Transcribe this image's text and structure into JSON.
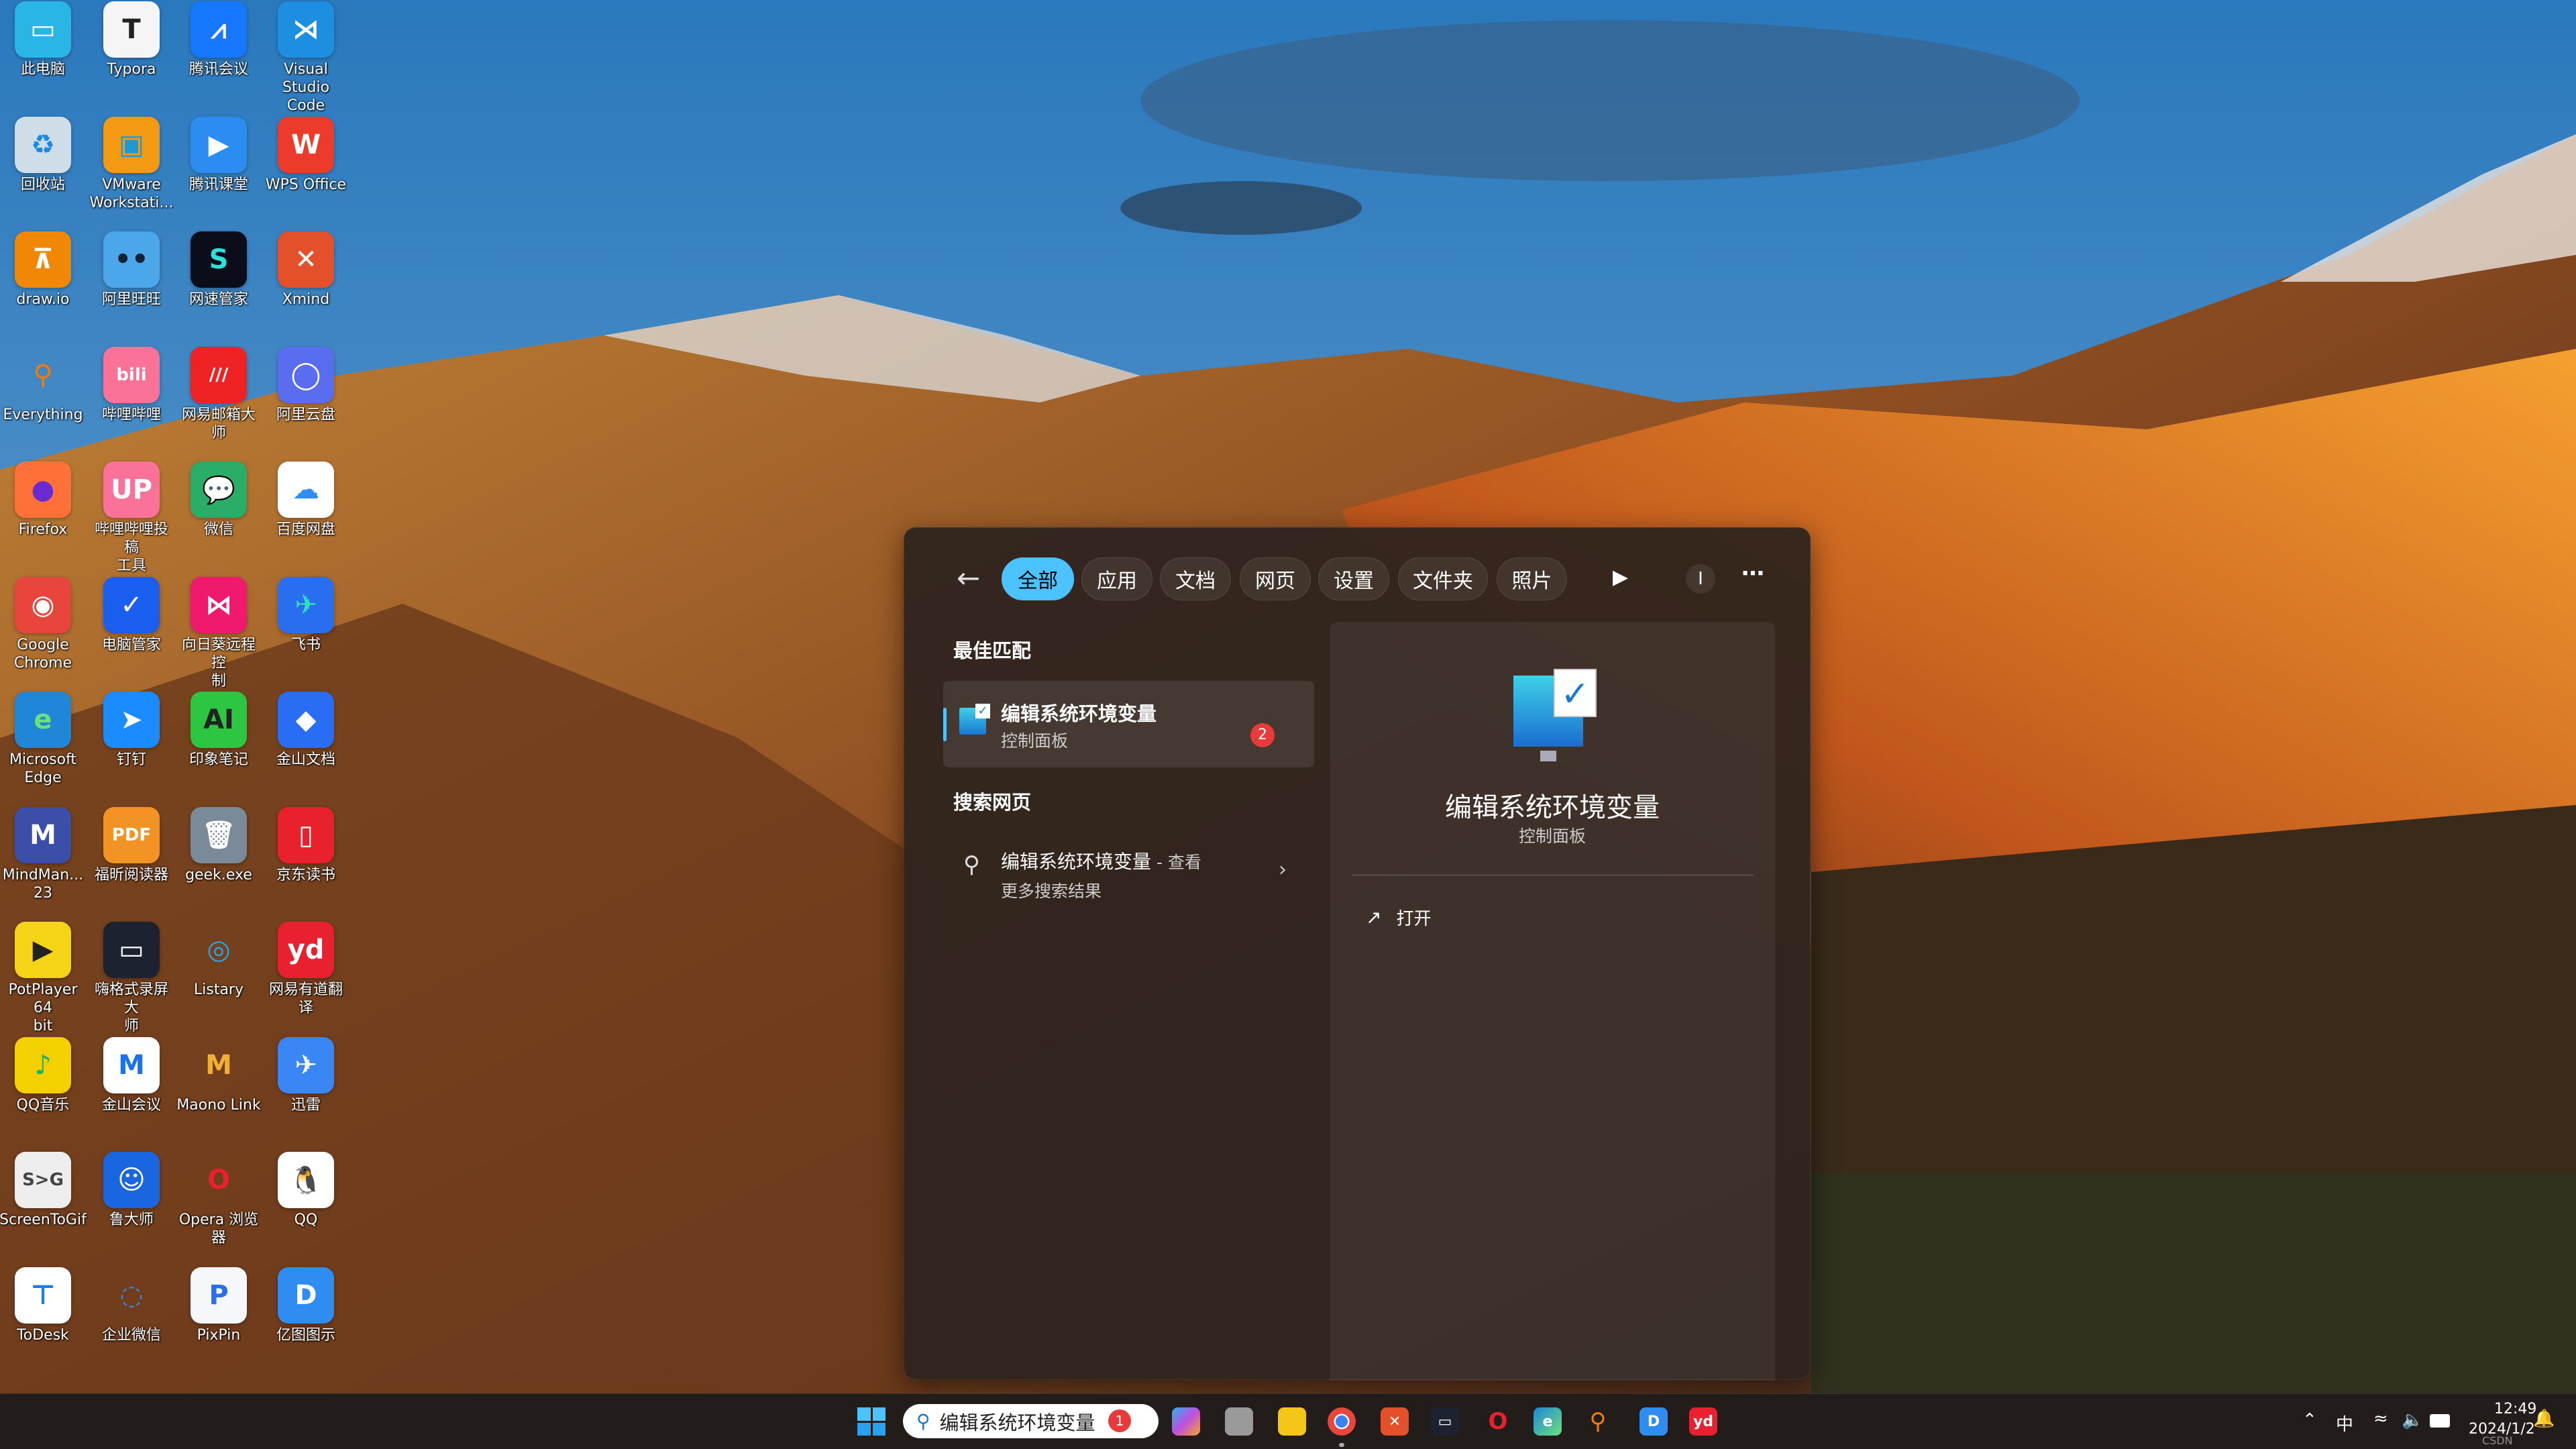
{
  "desktop": {
    "icons": [
      {
        "label": "此电脑",
        "bg": "#29b6e6",
        "fg": "#fff",
        "glyph": "▭"
      },
      {
        "label": "Typora",
        "bg": "#f5f5f5",
        "fg": "#222",
        "glyph": "T"
      },
      {
        "label": "腾讯会议",
        "bg": "#1677ff",
        "fg": "#fff",
        "glyph": "⩘"
      },
      {
        "label": "Visual\nStudio Code",
        "bg": "#1e8fe0",
        "fg": "#fff",
        "glyph": "⋊"
      },
      {
        "label": "回收站",
        "bg": "#cfdde8",
        "fg": "#1e88e5",
        "glyph": "♻"
      },
      {
        "label": "VMware\nWorkstati...",
        "bg": "#f39a12",
        "fg": "#1d9ad6",
        "glyph": "▣"
      },
      {
        "label": "腾讯课堂",
        "bg": "#2b8cf2",
        "fg": "#fff",
        "glyph": "▶"
      },
      {
        "label": "WPS Office",
        "bg": "#ec3b2b",
        "fg": "#fff",
        "glyph": "W"
      },
      {
        "label": "draw.io",
        "bg": "#f08705",
        "fg": "#fff",
        "glyph": "⊼"
      },
      {
        "label": "阿里旺旺",
        "bg": "#4ca6ea",
        "fg": "#123",
        "glyph": "••"
      },
      {
        "label": "网速管家",
        "bg": "#0b0d1a",
        "fg": "#2de0d8",
        "glyph": "S"
      },
      {
        "label": "Xmind",
        "bg": "#e4502a",
        "fg": "#fff",
        "glyph": "✕"
      },
      {
        "label": "Everything",
        "bg": "transparent",
        "fg": "#f57c00",
        "glyph": "⚲"
      },
      {
        "label": "哔哩哔哩",
        "bg": "#fb7299",
        "fg": "#fff",
        "glyph": "bili"
      },
      {
        "label": "网易邮箱大师",
        "bg": "#ee2222",
        "fg": "#fff",
        "glyph": "///"
      },
      {
        "label": "阿里云盘",
        "bg": "#5a6cf0",
        "fg": "#fff",
        "glyph": "◯"
      },
      {
        "label": "Firefox",
        "bg": "#ff7139",
        "fg": "#6a2ad0",
        "glyph": "●"
      },
      {
        "label": "哔哩哔哩投稿\n工具",
        "bg": "#fb7299",
        "fg": "#fff",
        "glyph": "UP"
      },
      {
        "label": "微信",
        "bg": "#2aae67",
        "fg": "#fff",
        "glyph": "💬"
      },
      {
        "label": "百度网盘",
        "bg": "#ffffff",
        "fg": "#2f8cf0",
        "glyph": "☁"
      },
      {
        "label": "Google\nChrome",
        "bg": "#e8453c",
        "fg": "#fff",
        "glyph": "◉"
      },
      {
        "label": "电脑管家",
        "bg": "#1a5ff0",
        "fg": "#fff",
        "glyph": "✓"
      },
      {
        "label": "向日葵远程控\n制",
        "bg": "#f0196e",
        "fg": "#fff",
        "glyph": "⋈"
      },
      {
        "label": "飞书",
        "bg": "#2a6ef0",
        "fg": "#2de0c0",
        "glyph": "✈"
      },
      {
        "label": "Microsoft\nEdge",
        "bg": "#1f86d8",
        "fg": "#6be07a",
        "glyph": "e"
      },
      {
        "label": "钉钉",
        "bg": "#1a8cff",
        "fg": "#fff",
        "glyph": "➤"
      },
      {
        "label": "印象笔记",
        "bg": "#2dc641",
        "fg": "#222",
        "glyph": "AI"
      },
      {
        "label": "金山文档",
        "bg": "#2a6df5",
        "fg": "#fff",
        "glyph": "◆"
      },
      {
        "label": "MindMan...\n23",
        "bg": "#3b4fa8",
        "fg": "#fff",
        "glyph": "M"
      },
      {
        "label": "福昕阅读器",
        "bg": "#f39324",
        "fg": "#fff",
        "glyph": "PDF"
      },
      {
        "label": "geek.exe",
        "bg": "#7a8a99",
        "fg": "#fff",
        "glyph": "🗑"
      },
      {
        "label": "京东读书",
        "bg": "#e8212c",
        "fg": "#fff",
        "glyph": "▯"
      },
      {
        "label": "PotPlayer 64\nbit",
        "bg": "#f5d316",
        "fg": "#222",
        "glyph": "▶"
      },
      {
        "label": "嗨格式录屏大\n师",
        "bg": "#1c2230",
        "fg": "#fff",
        "glyph": "▭"
      },
      {
        "label": "Listary",
        "bg": "transparent",
        "fg": "#2aa3e8",
        "glyph": "◎"
      },
      {
        "label": "网易有道翻译",
        "bg": "#e8202f",
        "fg": "#fff",
        "glyph": "yd"
      },
      {
        "label": "QQ音乐",
        "bg": "#f5d000",
        "fg": "#17b36a",
        "glyph": "♪"
      },
      {
        "label": "金山会议",
        "bg": "#ffffff",
        "fg": "#1a73e8",
        "glyph": "M"
      },
      {
        "label": "Maono Link",
        "bg": "transparent",
        "fg": "#f0b030",
        "glyph": "M"
      },
      {
        "label": "迅雷",
        "bg": "#3a86f5",
        "fg": "#fff",
        "glyph": "✈"
      },
      {
        "label": "ScreenToGif",
        "bg": "#eeeeee",
        "fg": "#444",
        "glyph": "S>G"
      },
      {
        "label": "鲁大师",
        "bg": "#1a66e0",
        "fg": "#fff",
        "glyph": "☺"
      },
      {
        "label": "Opera 浏览\n器",
        "bg": "transparent",
        "fg": "#e8202f",
        "glyph": "O"
      },
      {
        "label": "QQ",
        "bg": "#ffffff",
        "fg": "#000",
        "glyph": "🐧"
      },
      {
        "label": "ToDesk",
        "bg": "#ffffff",
        "fg": "#1a7cf0",
        "glyph": "⊤"
      },
      {
        "label": "企业微信",
        "bg": "transparent",
        "fg": "#2b8cf0",
        "glyph": "◌"
      },
      {
        "label": "PixPin",
        "bg": "#f5f7fa",
        "fg": "#2a6ef0",
        "glyph": "P"
      },
      {
        "label": "亿图图示",
        "bg": "#2f8cf0",
        "fg": "#fff",
        "glyph": "D"
      }
    ]
  },
  "search_panel": {
    "tabs": [
      "全部",
      "应用",
      "文档",
      "网页",
      "设置",
      "文件夹",
      "照片"
    ],
    "active_tab": "全部",
    "profile_initial": "I",
    "best_match_header": "最佳匹配",
    "best_match": {
      "title": "编辑系统环境变量",
      "subtitle": "控制面板",
      "badge": "2"
    },
    "web_header": "搜索网页",
    "web_result": {
      "title": "编辑系统环境变量",
      "suffix": " - 查看",
      "subtitle": "更多搜索结果"
    },
    "preview": {
      "title": "编辑系统环境变量",
      "subtitle": "控制面板",
      "actions": [
        {
          "label": "打开"
        }
      ]
    }
  },
  "taskbar": {
    "search_value": "编辑系统环境变量",
    "search_badge": "1",
    "apps": [
      {
        "name": "copilot",
        "bg": "linear-gradient(135deg,#2bb3f0,#c04ee0,#f5a623)",
        "glyph": ""
      },
      {
        "name": "task-view",
        "bg": "#9a9a9a",
        "glyph": ""
      },
      {
        "name": "file-explorer",
        "bg": "#f5c518",
        "glyph": ""
      },
      {
        "name": "chrome",
        "bg": "radial-gradient(circle,#3b82f0 30%,#fff 31%,#fff 38%,#e8453c 39%)",
        "glyph": ""
      },
      {
        "name": "xmind",
        "bg": "#e4502a",
        "glyph": "✕"
      },
      {
        "name": "screen-recorder",
        "bg": "#1c2230",
        "glyph": "▭"
      },
      {
        "name": "opera",
        "bg": "#221d1a",
        "glyph": "O",
        "fg": "#e8202f"
      },
      {
        "name": "edge",
        "bg": "linear-gradient(135deg,#1f86d8,#6be07a)",
        "glyph": "e"
      },
      {
        "name": "everything",
        "bg": "#221d1a",
        "glyph": "⚲",
        "fg": "#f57c00"
      },
      {
        "name": "edraw",
        "bg": "#2f8cf0",
        "glyph": "D"
      },
      {
        "name": "youdao",
        "bg": "#e8202f",
        "glyph": "yd"
      }
    ],
    "ime": "中",
    "time": "12:49",
    "date": "2024/1/2"
  },
  "watermark": "CSDN @ittimeline"
}
